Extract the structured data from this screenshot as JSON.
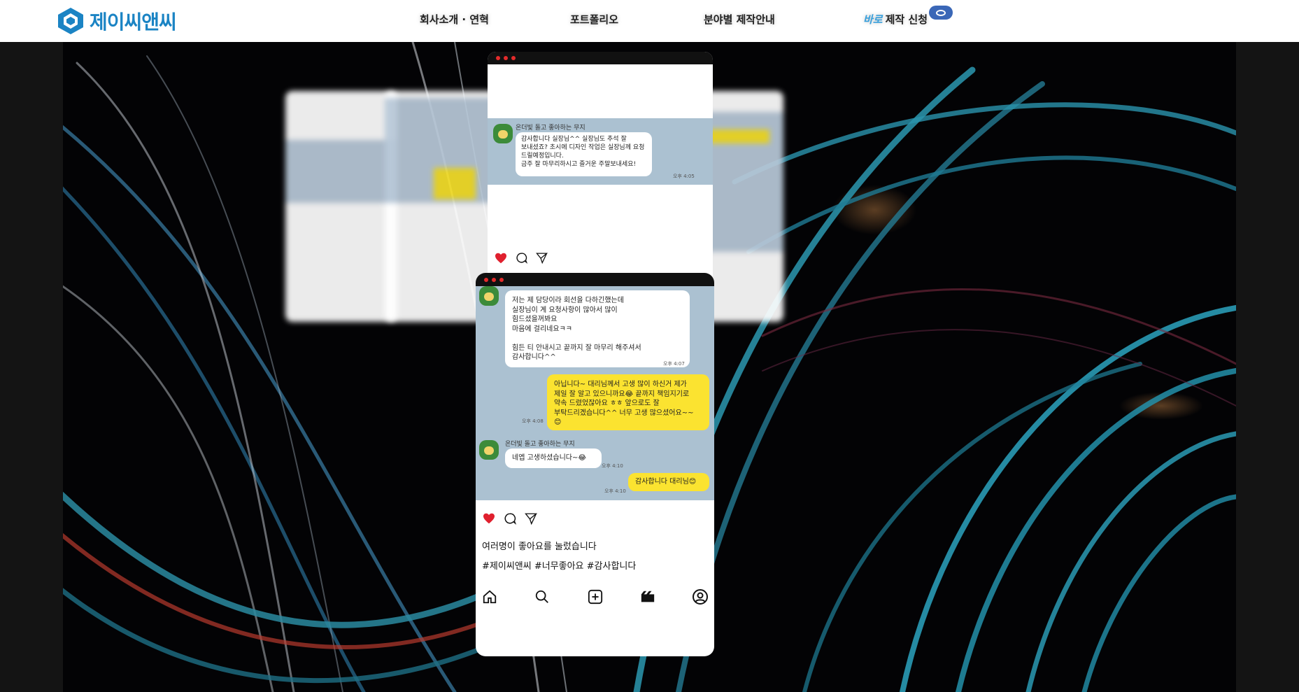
{
  "header": {
    "logo_text": "제이씨앤씨",
    "nav": [
      {
        "label": "회사소개 · 연혁"
      },
      {
        "label": "포트폴리오"
      },
      {
        "label": "분야별 제작안내"
      }
    ],
    "apply": {
      "prefix": "바로",
      "label": "제작 신청"
    }
  },
  "front_card": {
    "messages": [
      {
        "type": "received",
        "text": "저는 제 담당이라 회선을 다하긴했는데\n실장님이 계 요청사항이 많아서 많이\n힘드셨을꺼봐요\n마음에 걸리네요ㅋㅋ\n\n힘든 티 안내시고 끝까지 잘 마무리 해주셔서\n감사합니다^^",
        "time": "오후 4:07"
      },
      {
        "type": "sent",
        "text": "아닙니다~ 대리님께서 고생 많이 하신거 제가\n제일 잘 알고 있으니까요😂 끝까지 책임지기로\n약속 드렸었잖아요 ㅎㅎ 앞으로도 잘\n부탁드리겠습니다^^ 너무 고생 많으셨어요~~\n😊",
        "time": "오후 4:08"
      },
      {
        "type": "received",
        "sender": "온더빛 돌고 좋아하는 무지",
        "text": "네엡 고생하셨습니다~😂",
        "time": "오후 4:10"
      },
      {
        "type": "sent",
        "text": "감사합니다 대리님😊",
        "time": "오후 4:10"
      }
    ],
    "likes_text": "여러명이 좋아요를 눌렀습니다",
    "hashtags": "#제이씨앤씨 #너무좋아요 #감사합니다"
  },
  "mid_card": {
    "sender": "온더빛 돌고 좋아하는 무지",
    "message": "감사합니다 실장님^^ 실장님도 추석 잘\n보내셨죠? 초시에 디자인 작업은 실장님께 요청\n드릴예정입니다.\n금주 잘 마무리하시고 즐거운 주말보내세요!",
    "time": "오후 4:05"
  },
  "icons": [
    "home-icon",
    "search-icon",
    "add-icon",
    "reels-icon",
    "profile-icon",
    "heart-icon",
    "comment-icon",
    "send-icon"
  ],
  "colors": {
    "brand": "#1b84c4",
    "chat_bg": "#abc1d1",
    "bubble_yellow": "#fbe330",
    "heart": "#e0202e"
  }
}
